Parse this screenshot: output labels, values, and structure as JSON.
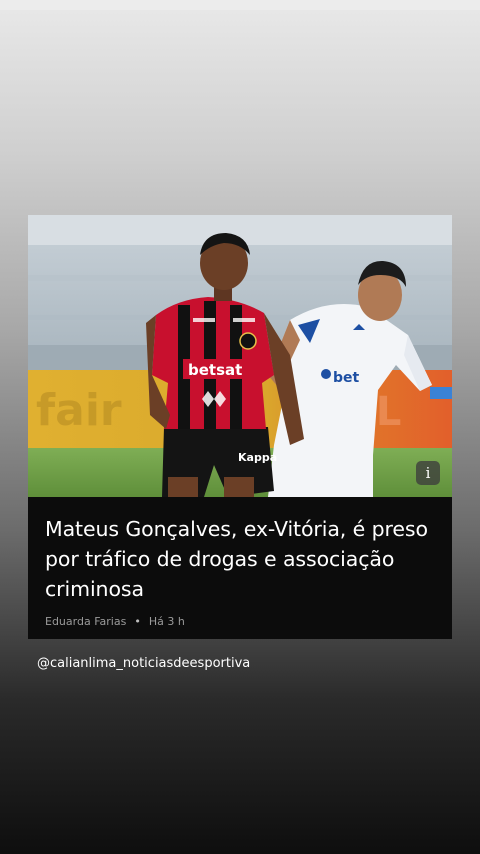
{
  "story": {
    "photo": {
      "subject": "two football players during a match",
      "left_shirt_sponsor": "betsat",
      "right_shirt_sponsor": "bet"
    },
    "info_icon": "info-icon",
    "headline": "Mateus Gonçalves, ex-Vitória, é preso por tráfico de drogas e associação criminosa",
    "author": "Eduarda Farias",
    "separator": "•",
    "time": "Há 3 h"
  },
  "mention": "@calianlima_noticiasdeesportiva",
  "colors": {
    "card_background": "#0c0c0c",
    "headline_text": "#ffffff",
    "byline_text": "#9a9a9a",
    "vitoria_red": "#c8102e",
    "cruzeiro_blue": "#1d4fa3"
  }
}
